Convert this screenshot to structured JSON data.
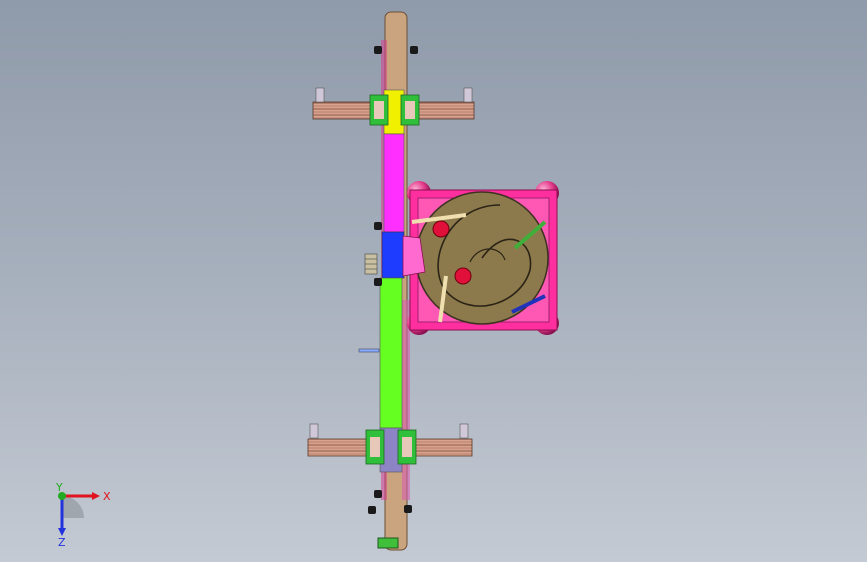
{
  "viewport": {
    "background_top": "#8f9aaa",
    "background_bottom": "#c4cad3"
  },
  "colors": {
    "rail": "#c9a47e",
    "rail_dark": "#8a6a4c",
    "yellow_segment": "#f0f000",
    "magenta_segment": "#ff30ff",
    "blue_segment": "#1e3cff",
    "green_segment": "#66ff22",
    "violet_segment": "#8c84c4",
    "roller": "#d8a28e",
    "roller_line": "#7a4a3a",
    "bracket": "#2fbf3a",
    "hopper_frame": "#ff2f9f",
    "hopper_disc": "#8c7a4c",
    "ball": "#e23a8a",
    "red_marker": "#e0103a"
  },
  "triad": {
    "x_label": "X",
    "y_label": "Y",
    "z_label": "Z",
    "x_color": "#e0141e",
    "y_color": "#22aa22",
    "z_color": "#2233dd"
  }
}
